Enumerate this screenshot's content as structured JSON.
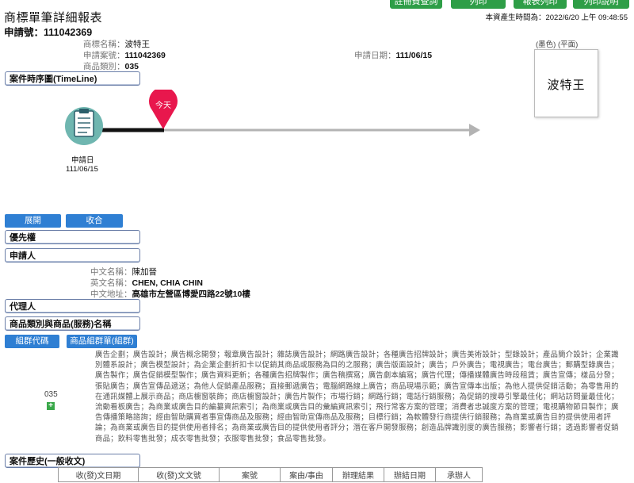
{
  "header": {
    "title": "商標單筆詳細報表",
    "application_no_label": "申請號：",
    "application_no": "111042369",
    "generated_label": "本資產生時間為：",
    "generated_at": "2022/6/20 上午 09:48:55",
    "buttons": [
      "註冊費查詢",
      "列印",
      "報表列印",
      "列印說明"
    ]
  },
  "basic": {
    "mark_name_label": "商標名稱：",
    "mark_name": "波特王",
    "appno_label": "申請案號：",
    "appno": "111042369",
    "class_label": "商品類別：",
    "class": "035",
    "appdate_label": "申請日期：",
    "appdate": "111/06/15"
  },
  "image": {
    "caption": "(墨色) (平面)",
    "text": "波特王"
  },
  "timeline": {
    "section_label": "案件時序圖(TimeLine)",
    "today_label": "今天",
    "event_label": "申請日",
    "event_date": "111/06/15",
    "colors": {
      "pin": "#e8174d",
      "line": "#111111",
      "arrow": "#b3b3b3",
      "clipboard": "#6fb6b0"
    }
  },
  "controls": {
    "expand_label": "展開",
    "collapse_label": "收合"
  },
  "sections": {
    "priority": "優先權",
    "applicant": "申請人",
    "agent": "代理人",
    "goods": "商品類別與商品(服務)名稱",
    "history": "案件歷史(一般收文)"
  },
  "applicant": {
    "cn_name_label": "中文名稱：",
    "cn_name": "陳加晉",
    "en_name_label": "英文名稱：",
    "en_name": "CHEN, CHIA CHIN",
    "cn_addr_label": "中文地址：",
    "cn_addr": "高雄市左營區博愛四路22號10樓"
  },
  "goods": {
    "group_code_label": "組群代碼",
    "group_list_label": "商品組群單(組群)",
    "class_no": "035",
    "expand_icon": "plus-icon",
    "description": "廣告企劃；廣告設計；廣告概念開發；報章廣告設計；雜誌廣告設計；網路廣告設計；各種廣告招牌設計；廣告美術設計；型錄設計；產品簡介設計；企業識別體系設計；廣告模型設計；為企業企劃折扣卡以促銷其商品或服務為目的之服務；廣告版面設計；廣告；戶外廣告；電視廣告；電台廣告；郵購型錄廣告；廣告製作；廣告促銷模型製作；廣告資料更新；各種廣告招牌製作；廣告稿撰寫；廣告劇本編寫；廣告代理；傳播媒體廣告時段租賃；廣告宣傳；樣品分發；張貼廣告；廣告宣傳品遞送；為他人促銷產品服務；直接郵遞廣告；電腦網路線上廣告；商品現場示範；廣告宣傳本出版；為他人提供促銷活動；為零售用的在通訊媒體上展示商品；商店櫥窗裝飾；商店櫥窗設計；廣告片製作；市場行銷；網路行銷；電話行銷服務；為促銷的搜尋引擎最佳化；網站訪問量最佳化；流動看板廣告；為商業或廣告目的編纂資訊索引；為商業或廣告目的彙編資訊索引；飛行常客方案的管理；消費者忠誠度方案的管理；電視購物節目製作；廣告傳播策略諮詢；經由智助購買者事宣傳商品及服務；經由智助宣傳商品及服務；目標行銷；為軟體發行商提供行銷服務；為商業或廣告目的提供使用者評論；為商業或廣告目的提供使用者排名；為商業或廣告目的提供使用者評分；潛在客戶開發服務；創造品牌識別度的廣告服務；影響者行銷；透過影響者促銷商品；飲料零售批發；成衣零售批發；衣服零售批發；食品零售批發。"
  },
  "history": {
    "columns": [
      "收(發)文日期",
      "收(發)文文號",
      "案號",
      "案由/事由",
      "辦理結果",
      "辦結日期",
      "承辦人"
    ]
  }
}
